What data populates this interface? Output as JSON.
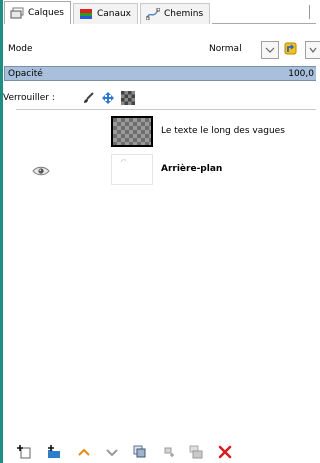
{
  "tabs": [
    {
      "label": "Calques",
      "icon": "layers-icon",
      "active": true
    },
    {
      "label": "Canaux",
      "icon": "channels-icon",
      "active": false
    },
    {
      "label": "Chemins",
      "icon": "paths-icon",
      "active": false
    }
  ],
  "mode": {
    "label": "Mode",
    "value": "Normal"
  },
  "opacity": {
    "label": "Opacité",
    "value": "100,0"
  },
  "lock": {
    "label": "Verrouiller :"
  },
  "layers": [
    {
      "name": "Le texte le long des vagues",
      "visible": false
    },
    {
      "name": "Arrière-plan",
      "visible": true
    }
  ],
  "colors": {
    "accent": "#1f8f83",
    "opacity_fill": "#a8c0dc"
  }
}
